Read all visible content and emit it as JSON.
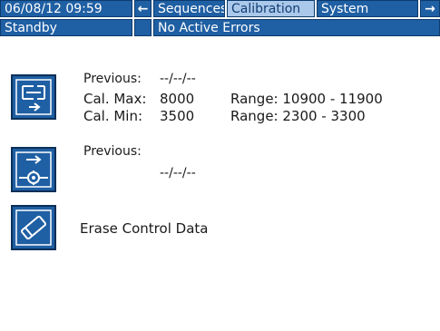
{
  "header": {
    "datetime": "06/08/12 09:59",
    "left_arrow": "←",
    "tabs": [
      "Sequences",
      "Calibration",
      "System"
    ],
    "right_arrow": "→",
    "active_tab": "Calibration"
  },
  "status": {
    "mode": "Standby",
    "errors": "No Active Errors"
  },
  "calibration": {
    "previous_label": "Previous:",
    "previous_value": "--/--/--",
    "max_label": "Cal. Max:",
    "max_value": "8000",
    "max_range": "Range: 10900 - 11900",
    "min_label": "Cal. Min:",
    "min_value": "3500",
    "min_range": "Range: 2300 - 3300"
  },
  "flow": {
    "previous_label": "Previous:",
    "previous_value": "--/--/--"
  },
  "erase": {
    "label": "Erase Control Data"
  },
  "colors": {
    "accent": "#1f5fa3",
    "active_tab": "#aac8ea"
  },
  "icons": {
    "calibrate": "calibrate-pump-icon",
    "flow": "flow-valve-icon",
    "erase": "eraser-icon"
  }
}
